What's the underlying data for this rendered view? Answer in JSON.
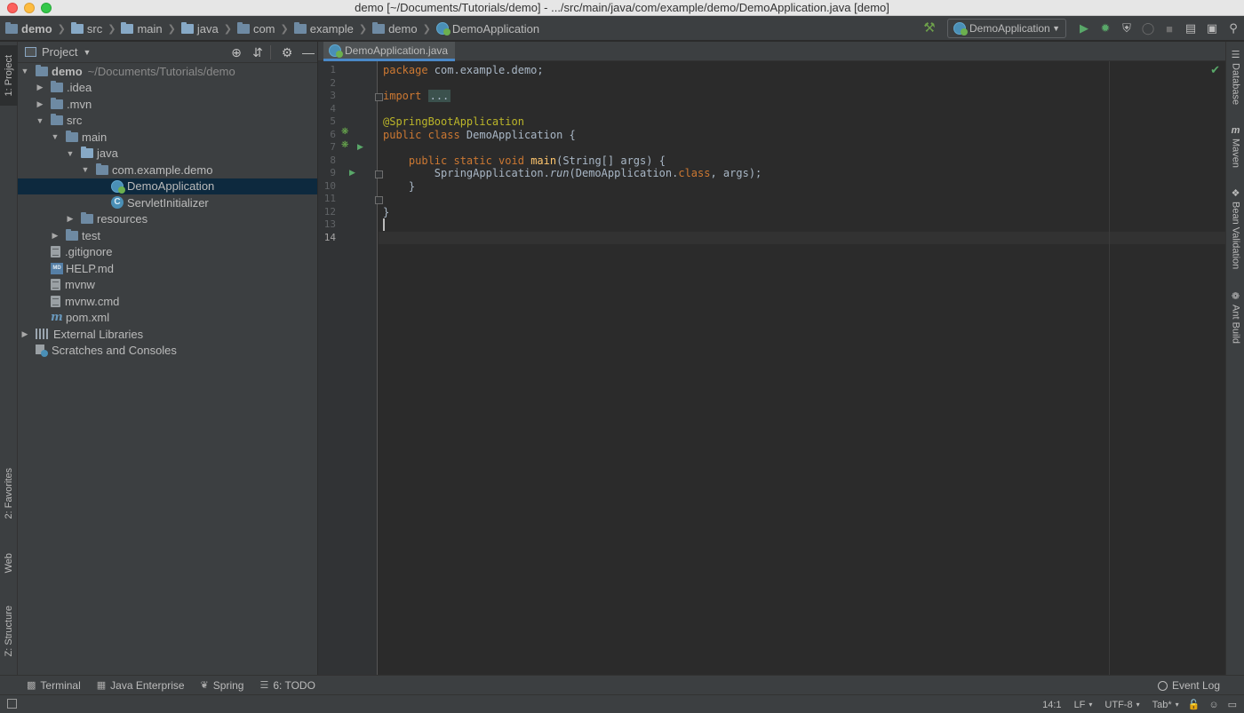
{
  "window": {
    "title": "demo [~/Documents/Tutorials/demo] - .../src/main/java/com/example/demo/DemoApplication.java [demo]"
  },
  "breadcrumbs": [
    {
      "label": "demo",
      "icon": "project-folder-icon"
    },
    {
      "label": "src",
      "icon": "folder-icon"
    },
    {
      "label": "main",
      "icon": "folder-icon"
    },
    {
      "label": "java",
      "icon": "source-folder-icon"
    },
    {
      "label": "com",
      "icon": "package-icon"
    },
    {
      "label": "example",
      "icon": "package-icon"
    },
    {
      "label": "demo",
      "icon": "package-icon"
    },
    {
      "label": "DemoApplication",
      "icon": "spring-boot-class-icon"
    }
  ],
  "toolbar": {
    "run_config": "DemoApplication"
  },
  "left_stripe": {
    "project": "1: Project",
    "favorites": "2: Favorites",
    "web": "Web",
    "structure": "Z: Structure"
  },
  "right_stripe": {
    "database": "Database",
    "maven": "Maven",
    "bean_validation": "Bean Validation",
    "ant_build": "Ant Build"
  },
  "project_panel": {
    "title": "Project",
    "tree": [
      {
        "label": "demo",
        "path": "~/Documents/Tutorials/demo"
      },
      {
        "label": ".idea"
      },
      {
        "label": ".mvn"
      },
      {
        "label": "src"
      },
      {
        "label": "main"
      },
      {
        "label": "java"
      },
      {
        "label": "com.example.demo"
      },
      {
        "label": "DemoApplication"
      },
      {
        "label": "ServletInitializer"
      },
      {
        "label": "resources"
      },
      {
        "label": "test"
      },
      {
        "label": ".gitignore"
      },
      {
        "label": "HELP.md"
      },
      {
        "label": "mvnw"
      },
      {
        "label": "mvnw.cmd"
      },
      {
        "label": "pom.xml"
      },
      {
        "label": "External Libraries"
      },
      {
        "label": "Scratches and Consoles"
      }
    ]
  },
  "editor": {
    "tab": "DemoApplication.java",
    "line_numbers": [
      "1",
      "2",
      "3",
      "4",
      "5",
      "6",
      "7",
      "8",
      "9",
      "10",
      "11",
      "12",
      "13",
      "14"
    ],
    "code": {
      "l1_kw": "package",
      "l1_rest": " com.example.demo;",
      "l3_kw": "import",
      "l3_fold": "...",
      "l6_ann": "@SpringBootApplication",
      "l7_kw": "public class",
      "l7_rest": " DemoApplication {",
      "l9_kw": "    public static void",
      "l9_fn": "main",
      "l9_rest": "(String[] args) {",
      "l10_a": "        SpringApplication.",
      "l10_run": "run",
      "l10_b": "(DemoApplication.",
      "l10_kw": "class",
      "l10_c": ", args);",
      "l11": "    }",
      "l13": "}"
    }
  },
  "bottom_tools": {
    "terminal": "Terminal",
    "java_enterprise": "Java Enterprise",
    "spring": "Spring",
    "todo": "6: TODO",
    "event_log": "Event Log"
  },
  "status": {
    "position": "14:1",
    "line_sep": "LF",
    "encoding": "UTF-8",
    "indent": "Tab*"
  }
}
